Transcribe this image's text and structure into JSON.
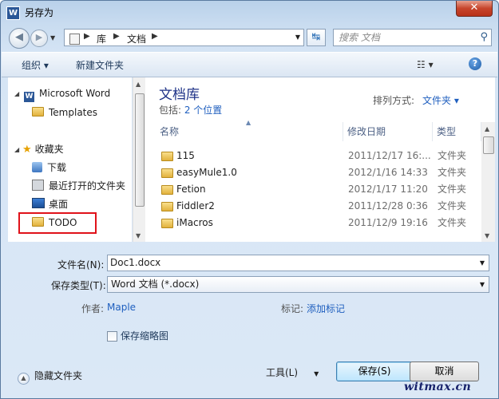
{
  "window": {
    "title": "另存为",
    "close_glyph": "✕",
    "app_icon_letter": "W"
  },
  "nav": {
    "breadcrumbs": [
      "库",
      "文档"
    ],
    "search_placeholder": "搜索 文档"
  },
  "toolbar": {
    "organize_label": "组织 ▾",
    "new_folder_label": "新建文件夹",
    "view_glyph": "☷ ▾",
    "help_glyph": "?"
  },
  "sidebar": {
    "items": [
      {
        "label": "Microsoft Word",
        "icon": "word-icon"
      },
      {
        "label": "Templates",
        "icon": "folder-icon"
      },
      {
        "label": "收藏夹",
        "icon": "star-icon"
      },
      {
        "label": "下载",
        "icon": "download-icon"
      },
      {
        "label": "最近打开的文件夹",
        "icon": "recent-icon"
      },
      {
        "label": "桌面",
        "icon": "desktop-icon"
      },
      {
        "label": "TODO",
        "icon": "folder-icon"
      }
    ]
  },
  "library": {
    "title": "文档库",
    "includes_label": "包括: ",
    "includes_link": "2 个位置",
    "arrange_label": "排列方式:",
    "arrange_value": "文件夹 ▾"
  },
  "columns": {
    "name": "名称",
    "modified": "修改日期",
    "type": "类型"
  },
  "files": [
    {
      "name": "115",
      "modified": "2011/12/17 16:...",
      "type": "文件夹"
    },
    {
      "name": "easyMule1.0",
      "modified": "2012/1/16 14:33",
      "type": "文件夹"
    },
    {
      "name": "Fetion",
      "modified": "2012/1/17 11:20",
      "type": "文件夹"
    },
    {
      "name": "Fiddler2",
      "modified": "2011/12/28 0:36",
      "type": "文件夹"
    },
    {
      "name": "iMacros",
      "modified": "2011/12/9 19:16",
      "type": "文件夹"
    }
  ],
  "form": {
    "filename_label": "文件名(N):",
    "filename_value": "Doc1.docx",
    "savetype_label": "保存类型(T):",
    "savetype_value": "Word 文档 (*.docx)",
    "author_label": "作者:",
    "author_value": "Maple",
    "tags_label": "标记:",
    "tags_link": "添加标记",
    "thumbnail_label": "保存缩略图"
  },
  "bottom": {
    "hide_folders": "隐藏文件夹",
    "tools_label": "工具(L)",
    "save_label": "保存(S)",
    "cancel_label": "取消",
    "watermark": "witmax.cn"
  },
  "colors": {
    "highlight_box": "#e0121a",
    "link": "#1f5fbf",
    "library_title": "#1e3287"
  }
}
